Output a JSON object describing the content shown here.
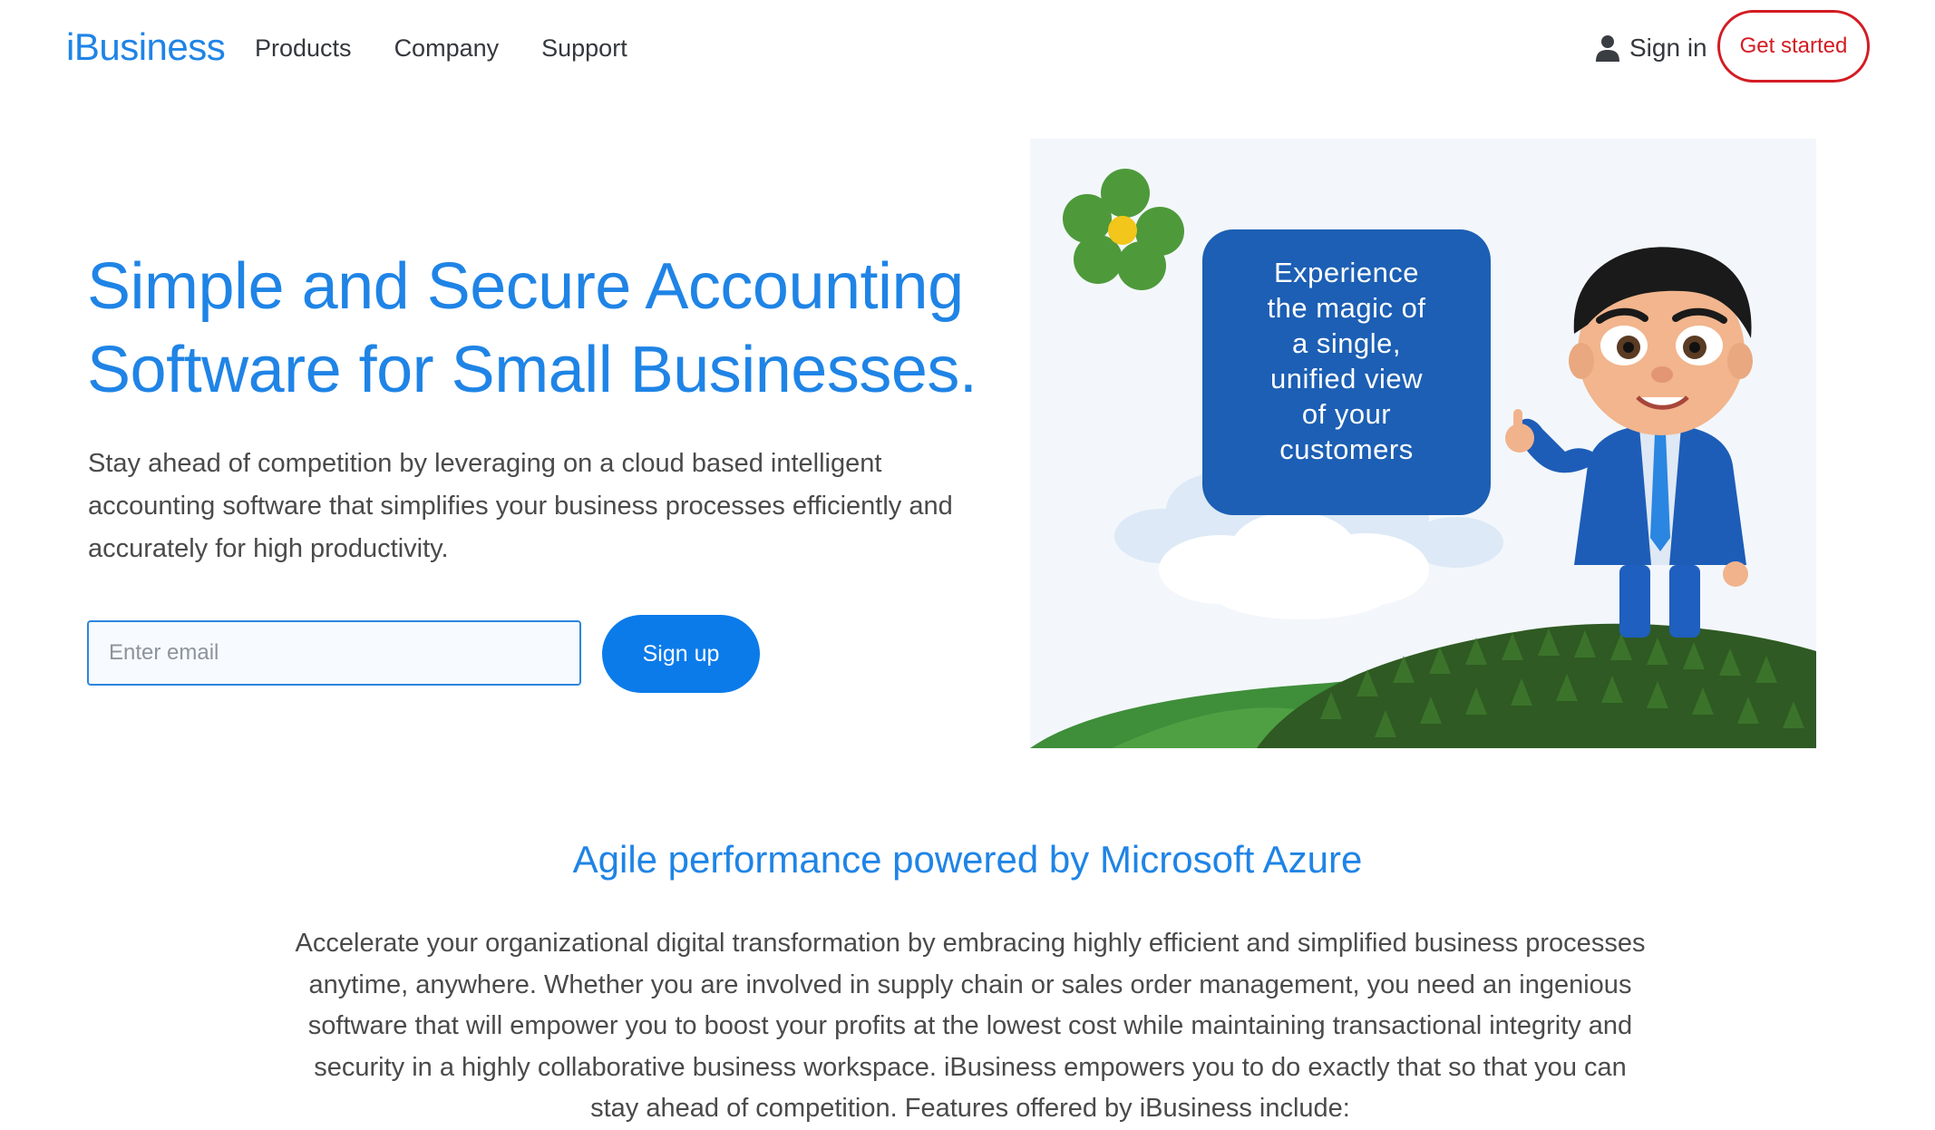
{
  "header": {
    "logo": "iBusiness",
    "nav": [
      "Products",
      "Company",
      "Support"
    ],
    "sign_in": "Sign in",
    "get_started": "Get started",
    "icons": {
      "user": "user-icon"
    }
  },
  "hero": {
    "title_line1": "Simple and Secure Accounting",
    "title_line2": "Software for Small Businesses.",
    "description": "Stay ahead of competition by leveraging on a cloud based intelligent accounting software that simplifies your business processes efficiently and accurately for high productivity.",
    "email_placeholder": "Enter email",
    "email_value": "",
    "signup_label": "Sign up"
  },
  "illustration": {
    "bubble_lines": [
      "Experience",
      "the magic of",
      "a single,",
      "unified view",
      "of your",
      "customers"
    ]
  },
  "section": {
    "title": "Agile performance powered by Microsoft Azure",
    "description": "Accelerate your organizational digital transformation by embracing highly efficient and simplified business processes anytime, anywhere. Whether you are involved in supply chain or sales order management, you need an ingenious software that will empower you to boost your profits at the lowest cost while maintaining transactional integrity and security in a highly collaborative business workspace. iBusiness empowers you to do exactly that so that you can stay ahead of competition. Features offered by iBusiness include:"
  },
  "colors": {
    "brand_blue": "#1f84e6",
    "button_blue": "#0b7bea",
    "accent_red": "#d31c24",
    "bubble_blue": "#1c5fb4"
  }
}
